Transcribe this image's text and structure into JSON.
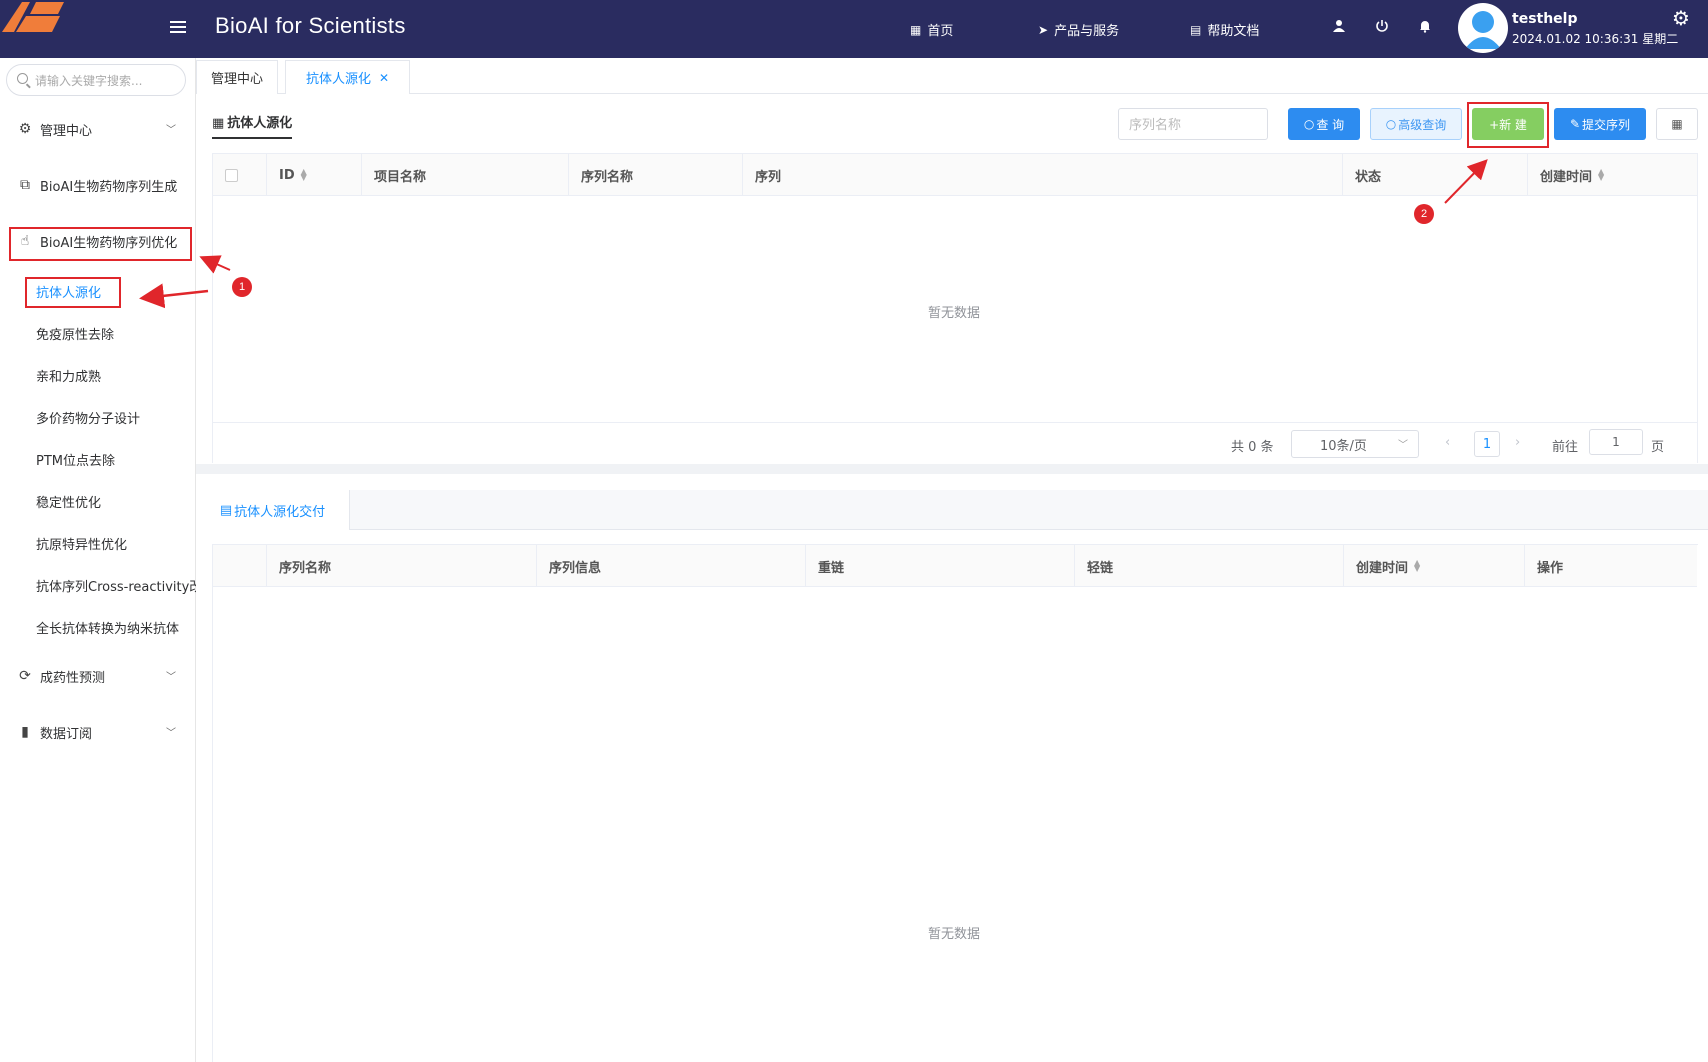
{
  "header": {
    "app_title": "BioAI for Scientists",
    "nav": [
      {
        "label": "首页",
        "icon": "grid-icon"
      },
      {
        "label": "产品与服务",
        "icon": "send-icon"
      },
      {
        "label": "帮助文档",
        "icon": "doc-icon"
      }
    ],
    "user_name": "testhelp",
    "datetime": "2024.01.02 10:36:31 星期二",
    "brand_color": "#2a2c60"
  },
  "sidebar": {
    "search_placeholder": "请输入关键字搜索...",
    "menu": [
      {
        "label": "管理中心"
      },
      {
        "label": "BioAI生物药物序列生成"
      },
      {
        "label": "BioAI生物药物序列优化"
      },
      {
        "label": "成药性预测"
      },
      {
        "label": "数据订阅"
      }
    ],
    "sub_items": [
      {
        "label": "抗体人源化"
      },
      {
        "label": "免疫原性去除"
      },
      {
        "label": "亲和力成熟"
      },
      {
        "label": "多价药物分子设计"
      },
      {
        "label": "PTM位点去除"
      },
      {
        "label": "稳定性优化"
      },
      {
        "label": "抗原特异性优化"
      },
      {
        "label": "抗体序列Cross-reactivity改"
      },
      {
        "label": "全长抗体转换为纳米抗体"
      }
    ]
  },
  "tabs": [
    {
      "label": "管理中心"
    },
    {
      "label": "抗体人源化",
      "close": "✕"
    }
  ],
  "main": {
    "panel_title": "抗体人源化",
    "search_placeholder": "序列名称",
    "buttons": {
      "query": "查 询",
      "advanced_query": "高级查询",
      "new": "+新 建",
      "submit_sequence": "提交序列"
    },
    "table_columns": [
      "ID",
      "项目名称",
      "序列名称",
      "序列",
      "状态",
      "创建时间"
    ],
    "empty_text": "暂无数据",
    "pager": {
      "total": "共 0 条",
      "page_size": "10条/页",
      "current_page": "1",
      "goto_label": "前往",
      "goto_value": "1",
      "page_suffix": "页"
    }
  },
  "delivery": {
    "tab_label": "抗体人源化交付",
    "table_columns": [
      "序列名称",
      "序列信息",
      "重链",
      "轻链",
      "创建时间",
      "操作"
    ],
    "empty_text": "暂无数据"
  },
  "annotations": {
    "step1": "1",
    "step2": "2",
    "color": "#e0262b"
  }
}
